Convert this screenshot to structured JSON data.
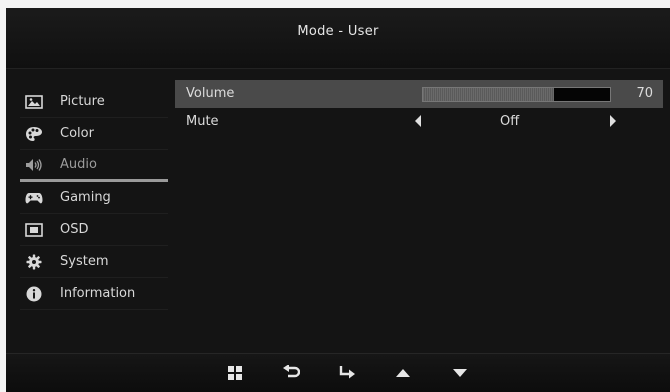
{
  "header": {
    "title": "Mode - User"
  },
  "sidebar": {
    "items": [
      {
        "label": "Picture",
        "icon": "picture-icon"
      },
      {
        "label": "Color",
        "icon": "palette-icon"
      },
      {
        "label": "Audio",
        "icon": "speaker-icon",
        "active": true
      },
      {
        "label": "Gaming",
        "icon": "gamepad-icon"
      },
      {
        "label": "OSD",
        "icon": "osd-icon"
      },
      {
        "label": "System",
        "icon": "gear-icon"
      },
      {
        "label": "Information",
        "icon": "info-icon"
      }
    ]
  },
  "content": {
    "volume": {
      "label": "Volume",
      "value": "70",
      "level": 0.7
    },
    "mute": {
      "label": "Mute",
      "value": "Off"
    }
  },
  "footer": {
    "buttons": [
      "menu-icon",
      "back-icon",
      "enter-icon",
      "up-arrow-icon",
      "down-arrow-icon"
    ]
  },
  "colors": {
    "background": "#141414",
    "selected_row": "#4a4a4a",
    "text": "#dcdcdc"
  }
}
